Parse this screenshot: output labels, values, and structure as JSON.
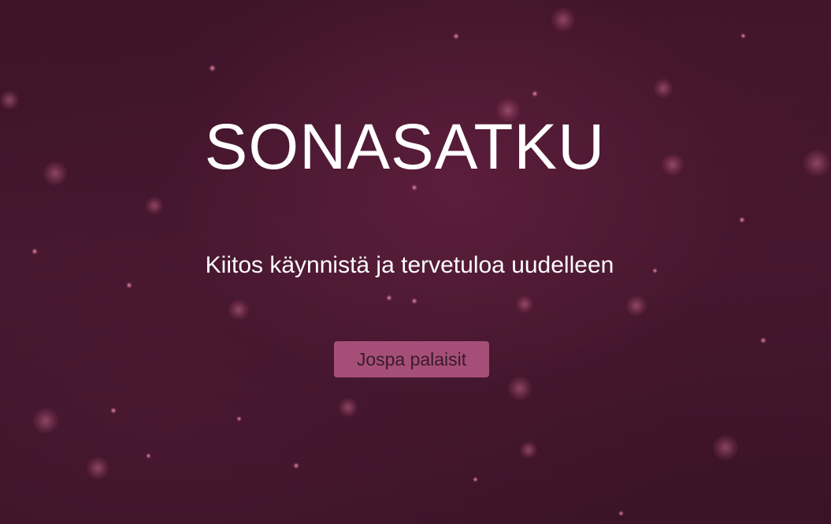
{
  "title": "SONASATKU",
  "subtitle": "Kiitos käynnistä ja tervetuloa uudelleen",
  "return_button": {
    "label": "Jospa palaisit"
  },
  "colors": {
    "background": "#3d1429",
    "button": "#a54f78",
    "button_text": "#3a1a2a",
    "text": "#ffffff"
  }
}
